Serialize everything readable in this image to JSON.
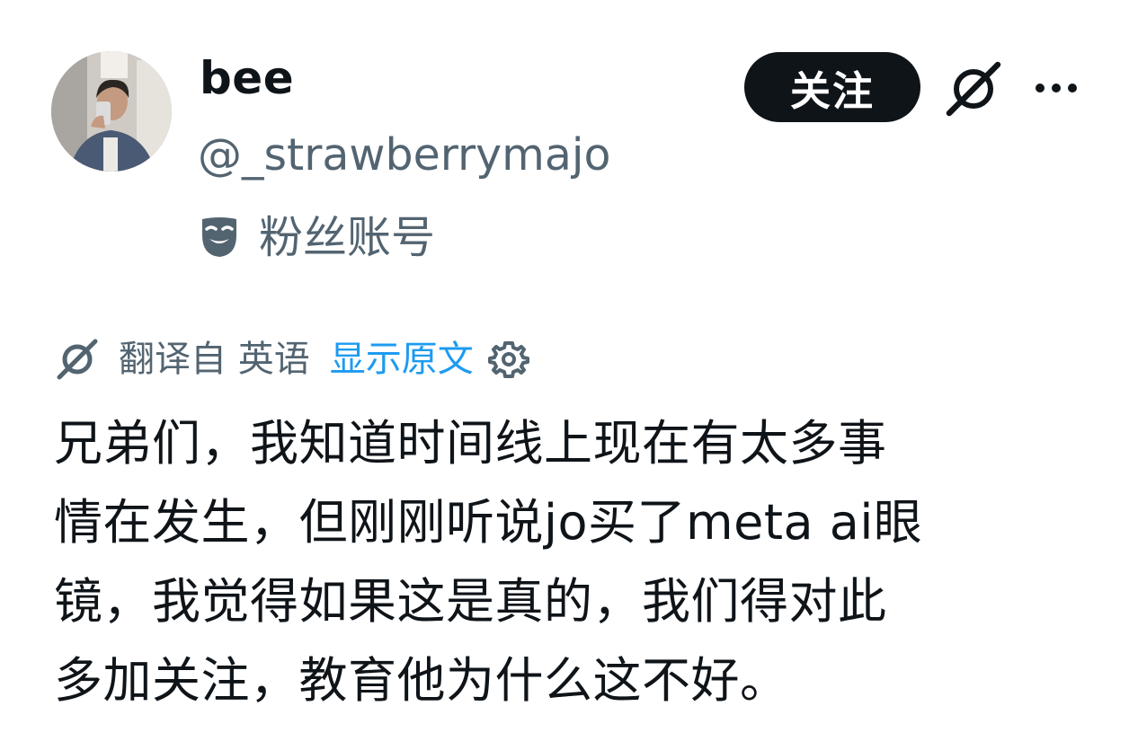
{
  "user": {
    "display_name": "bee",
    "handle": "@_strawberrymajo",
    "account_label": "粉丝账号",
    "account_icon": "mask-icon"
  },
  "actions": {
    "follow_label": "关注",
    "grok_icon": "grok-icon",
    "more_icon": "more-icon"
  },
  "translation": {
    "label": "翻译自 英语",
    "show_original": "显示原文",
    "settings_icon": "gear-icon"
  },
  "post": {
    "lines": [
      "兄弟们，我知道时间线上现在有太多事",
      "情在发生，但刚刚听说jo买了meta ai眼",
      "镜，我觉得如果这是真的，我们得对此",
      "多加关注，教育他为什么这不好。"
    ]
  },
  "colors": {
    "text_primary": "#0f1419",
    "text_secondary": "#536471",
    "link": "#1d9bf0",
    "button_bg": "#0f1419",
    "button_text": "#ffffff"
  }
}
